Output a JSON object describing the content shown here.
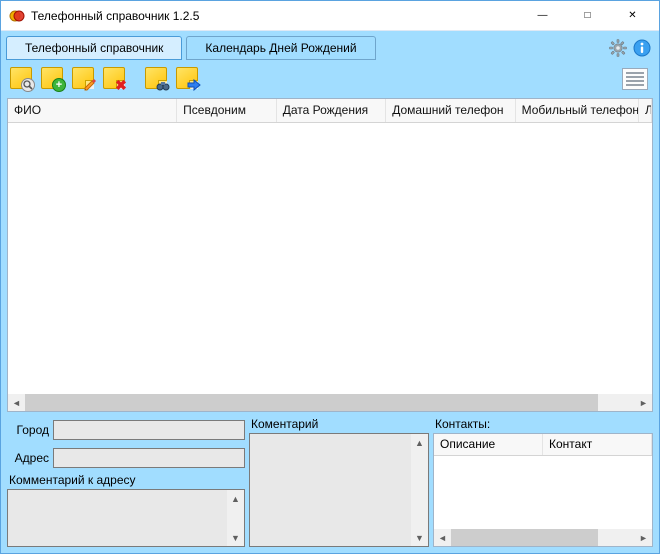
{
  "window": {
    "title": "Телефонный справочник 1.2.5"
  },
  "tabs": {
    "phonebook": "Телефонный справочник",
    "birthdays": "Календарь Дней Рождений"
  },
  "grid": {
    "columns": {
      "fio": "ФИО",
      "nick": "Псевдоним",
      "dob": "Дата Рождения",
      "home": "Домашний телефон",
      "mobile": "Мобильный телефон",
      "overflow": "Л"
    }
  },
  "form": {
    "city_label": "Город",
    "address_label": "Адрес",
    "address_comment_label": "Комментарий к адресу",
    "comment_label": "Коментарий",
    "contacts_label": "Контакты:",
    "city_value": "",
    "address_value": ""
  },
  "contacts_grid": {
    "col_desc": "Описание",
    "col_contact": "Контакт"
  },
  "icons": {
    "settings": "gear",
    "info": "info"
  }
}
